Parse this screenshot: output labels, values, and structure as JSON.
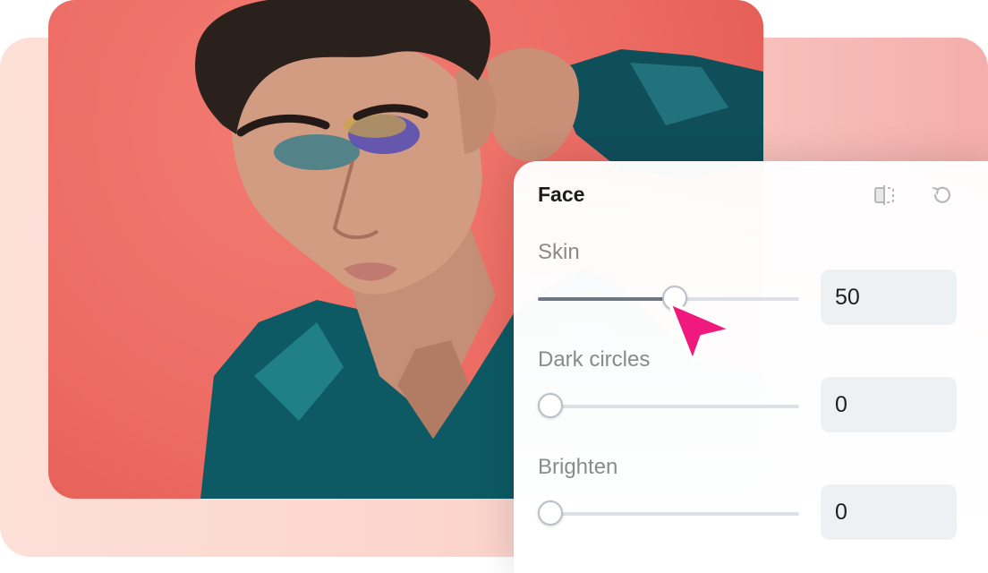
{
  "panel": {
    "title": "Face",
    "icons": {
      "compare": "compare-split-icon",
      "reset": "reset-icon"
    },
    "sliders": [
      {
        "label": "Skin",
        "value": "50",
        "level": 0.5
      },
      {
        "label": "Dark circles",
        "value": "0",
        "level": 0
      },
      {
        "label": "Brighten",
        "value": "0",
        "level": 0
      }
    ]
  },
  "colors": {
    "photo_background": "#ec6b63",
    "cursor": "#f0197d",
    "slider_fill": "#6e7781",
    "value_box": "#eef1f4"
  }
}
